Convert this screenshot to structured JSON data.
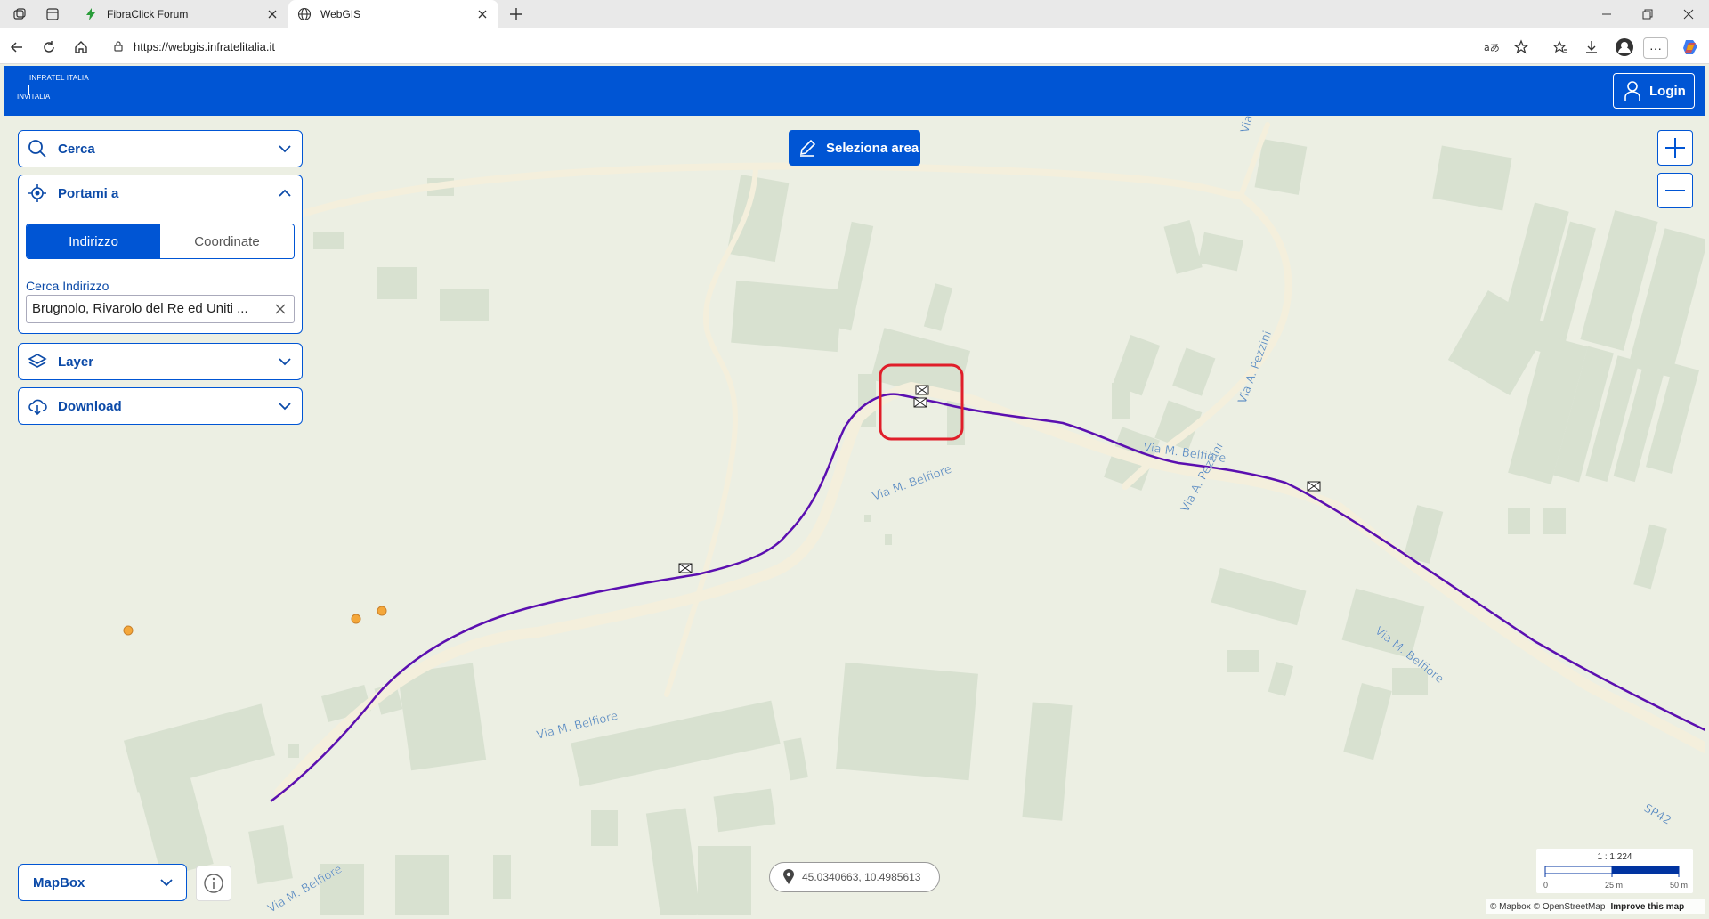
{
  "browser": {
    "tabs": [
      {
        "title": "FibraClick Forum",
        "active": false
      },
      {
        "title": "WebGIS",
        "active": true
      }
    ],
    "url": "https://webgis.infratelitalia.it"
  },
  "header": {
    "logo_top": "INFRATEL ITALIA",
    "logo_bottom": "INVITALIA",
    "login_label": "Login",
    "brand_color": "#0055d4"
  },
  "panel": {
    "cerca": {
      "label": "Cerca",
      "icon": "search-icon",
      "expanded": false
    },
    "portami": {
      "label": "Portami a",
      "icon": "target-icon",
      "expanded": true,
      "tabs": [
        "Indirizzo",
        "Coordinate"
      ],
      "selected_tab": "Indirizzo",
      "field_label": "Cerca Indirizzo",
      "field_value": "Brugnolo, Rivarolo del Re ed Uniti ..."
    },
    "layer": {
      "label": "Layer",
      "icon": "layers-icon",
      "expanded": false
    },
    "download": {
      "label": "Download",
      "icon": "cloud-download-icon",
      "expanded": false
    }
  },
  "map": {
    "seleziona_label": "Seleziona area",
    "zoom_in": "zoom-in-icon",
    "zoom_out": "zoom-out-icon",
    "basemap_label": "MapBox",
    "coordinates": "45.0340663, 10.4985613",
    "scale": {
      "ratio": "1 : 1.224",
      "ticks": [
        "0",
        "25 m",
        "50 m"
      ]
    },
    "attribution": {
      "mapbox": "© Mapbox",
      "osm": "© OpenStreetMap",
      "improve": "Improve this map"
    },
    "street_labels": {
      "belfiore": "Via M. Belfiore",
      "pezzini": "Via A. Pezzini",
      "via": "Via",
      "sp42": "SP42"
    },
    "fiber_color": "#5b0fb0",
    "highlight_color": "#e01e2a"
  }
}
